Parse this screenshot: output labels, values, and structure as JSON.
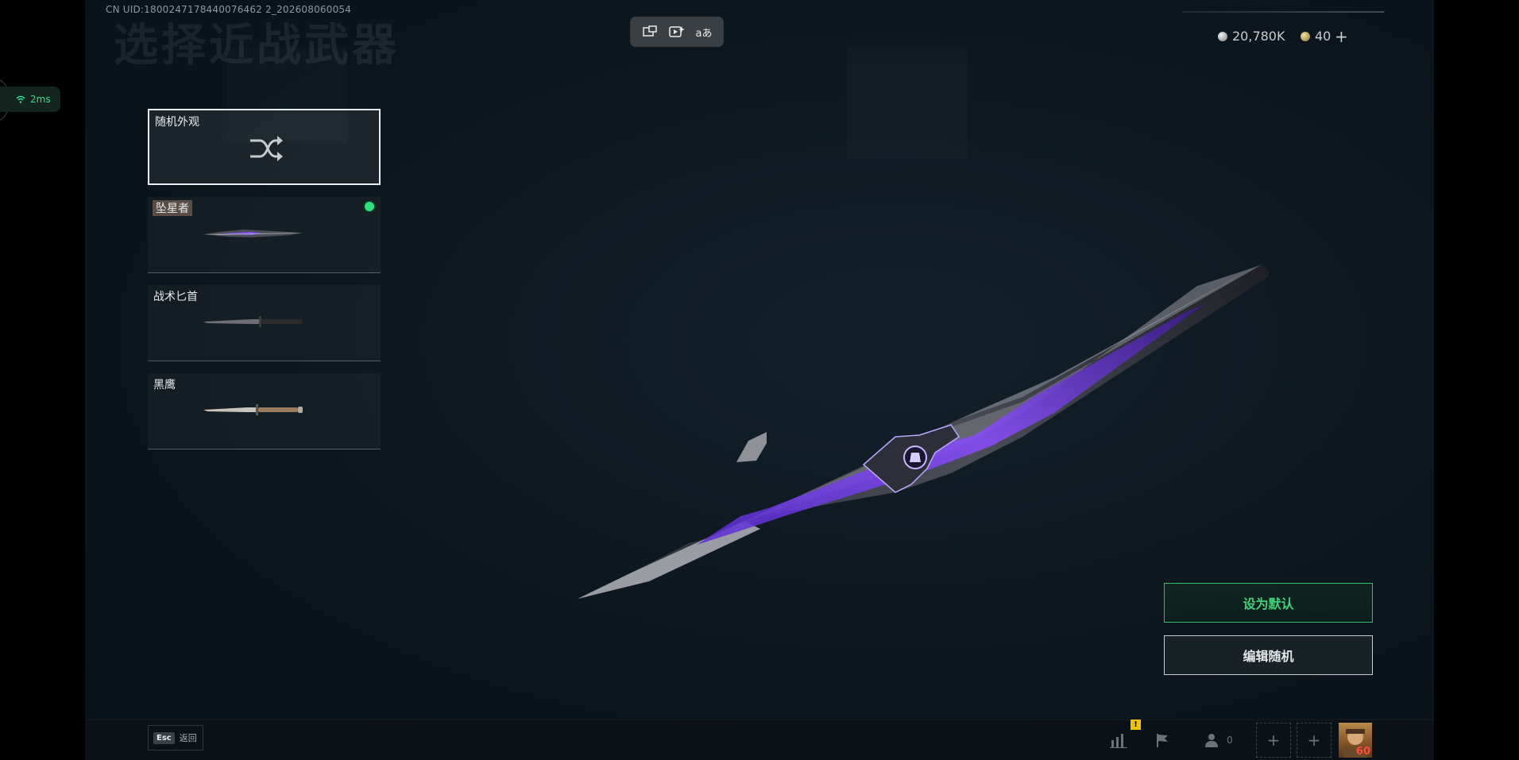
{
  "header": {
    "uid": "CN UID:1800247178440076462 2_202608060054",
    "page_title": "选择近战武器"
  },
  "toolbar": {
    "icons": [
      "screen-switch-icon",
      "video-spark-icon",
      "translate-icon"
    ],
    "translate_glyph": "aあ"
  },
  "network": {
    "ping": "2ms"
  },
  "currency": {
    "silver": "20,780K",
    "gold": "40",
    "add_label": "+"
  },
  "skins": [
    {
      "name": "随机外观",
      "type": "random",
      "selected": true
    },
    {
      "name": "坠星者",
      "equipped": true
    },
    {
      "name": "战术匕首"
    },
    {
      "name": "黑鹰"
    }
  ],
  "actions": {
    "set_default": "设为默认",
    "edit_random": "编辑随机"
  },
  "bottom": {
    "esc_key": "Esc",
    "esc_label": "返回",
    "warn_badge": "!",
    "friends_count": "0",
    "avatar_level": "60"
  },
  "colors": {
    "accent_green": "#3fd17a",
    "weapon_purple": "#7a3cff"
  }
}
